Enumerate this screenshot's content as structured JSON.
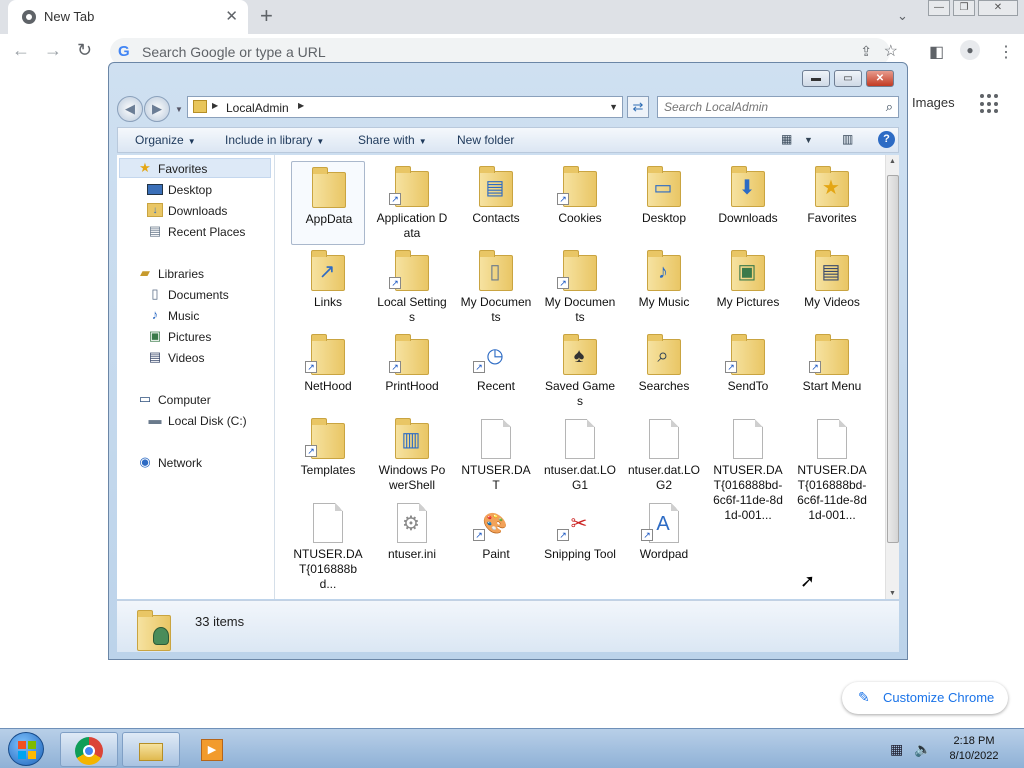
{
  "browser": {
    "tab_title": "New Tab",
    "omnibox_placeholder": "Search Google or type a URL",
    "ntp_images_link": "Images",
    "customize_button": "Customize Chrome"
  },
  "explorer": {
    "breadcrumb": [
      "LocalAdmin"
    ],
    "search_placeholder": "Search LocalAdmin",
    "commands": {
      "organize": "Organize",
      "include_in_library": "Include in library",
      "share_with": "Share with",
      "new_folder": "New folder"
    },
    "nav_pane": {
      "favorites_header": "Favorites",
      "favorites": [
        "Desktop",
        "Downloads",
        "Recent Places"
      ],
      "libraries_header": "Libraries",
      "libraries": [
        "Documents",
        "Music",
        "Pictures",
        "Videos"
      ],
      "computer_header": "Computer",
      "computer": [
        "Local Disk (C:)"
      ],
      "network_header": "Network"
    },
    "files": [
      {
        "name": "AppData",
        "icon": "folder-icon",
        "shortcut": false,
        "selected": true
      },
      {
        "name": "Application Data",
        "icon": "folder-icon",
        "shortcut": true
      },
      {
        "name": "Contacts",
        "icon": "contacts-folder-icon",
        "shortcut": false
      },
      {
        "name": "Cookies",
        "icon": "folder-icon",
        "shortcut": true
      },
      {
        "name": "Desktop",
        "icon": "desktop-folder-icon",
        "shortcut": false
      },
      {
        "name": "Downloads",
        "icon": "downloads-folder-icon",
        "shortcut": false
      },
      {
        "name": "Favorites",
        "icon": "favorites-folder-icon",
        "shortcut": false
      },
      {
        "name": "Links",
        "icon": "links-folder-icon",
        "shortcut": false
      },
      {
        "name": "Local Settings",
        "icon": "folder-icon",
        "shortcut": true
      },
      {
        "name": "My Documents",
        "icon": "documents-folder-icon",
        "shortcut": false
      },
      {
        "name": "My Documents",
        "icon": "folder-icon",
        "shortcut": true
      },
      {
        "name": "My Music",
        "icon": "music-folder-icon",
        "shortcut": false
      },
      {
        "name": "My Pictures",
        "icon": "pictures-folder-icon",
        "shortcut": false
      },
      {
        "name": "My Videos",
        "icon": "videos-folder-icon",
        "shortcut": false
      },
      {
        "name": "NetHood",
        "icon": "folder-icon",
        "shortcut": true
      },
      {
        "name": "PrintHood",
        "icon": "folder-icon",
        "shortcut": true
      },
      {
        "name": "Recent",
        "icon": "recent-icon",
        "shortcut": true
      },
      {
        "name": "Saved Games",
        "icon": "saved-games-folder-icon",
        "shortcut": false
      },
      {
        "name": "Searches",
        "icon": "searches-folder-icon",
        "shortcut": false
      },
      {
        "name": "SendTo",
        "icon": "folder-icon",
        "shortcut": true
      },
      {
        "name": "Start Menu",
        "icon": "folder-icon",
        "shortcut": true
      },
      {
        "name": "Templates",
        "icon": "folder-icon",
        "shortcut": true
      },
      {
        "name": "Windows PowerShell",
        "icon": "powershell-folder-icon",
        "shortcut": false
      },
      {
        "name": "NTUSER.DAT",
        "icon": "file-icon",
        "shortcut": false
      },
      {
        "name": "ntuser.dat.LOG1",
        "icon": "file-icon",
        "shortcut": false
      },
      {
        "name": "ntuser.dat.LOG2",
        "icon": "file-icon",
        "shortcut": false
      },
      {
        "name": "NTUSER.DAT{016888bd-6c6f-11de-8d1d-001...",
        "icon": "file-icon",
        "shortcut": false
      },
      {
        "name": "NTUSER.DAT{016888bd-6c6f-11de-8d1d-001...",
        "icon": "file-icon",
        "shortcut": false
      },
      {
        "name": "NTUSER.DAT{016888bd...",
        "icon": "file-icon",
        "shortcut": false
      },
      {
        "name": "ntuser.ini",
        "icon": "settings-file-icon",
        "shortcut": false
      },
      {
        "name": "Paint",
        "icon": "paint-icon",
        "shortcut": true
      },
      {
        "name": "Snipping Tool",
        "icon": "snipping-tool-icon",
        "shortcut": true
      },
      {
        "name": "Wordpad",
        "icon": "wordpad-icon",
        "shortcut": true
      }
    ],
    "status_text": "33 items"
  },
  "taskbar": {
    "clock_time": "2:18 PM",
    "clock_date": "8/10/2022",
    "pinned": [
      "chrome-icon",
      "explorer-icon",
      "media-player-icon"
    ]
  },
  "colors": {
    "explorer_frame": "#bcd3ea",
    "chrome_tabstrip": "#dee1e6",
    "accent_blue": "#1a73e8",
    "folder_yellow": "#e9c665"
  }
}
